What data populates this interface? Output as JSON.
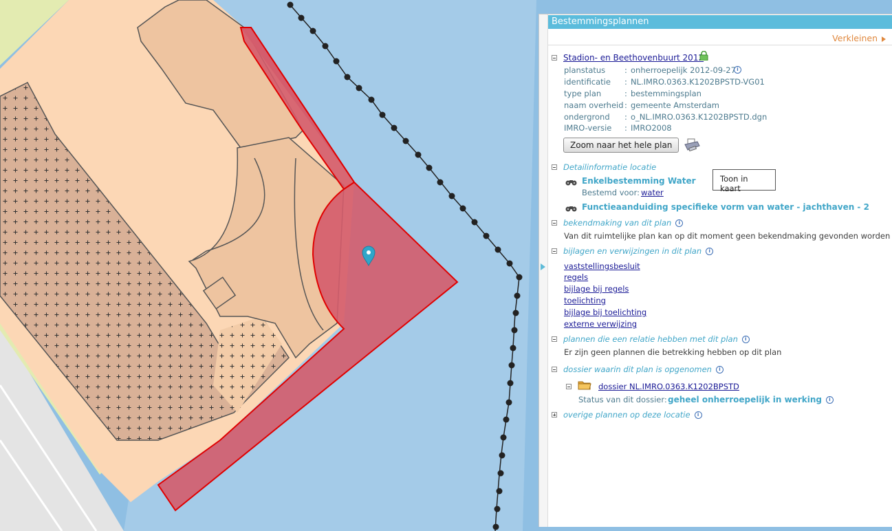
{
  "map": {
    "water_color": "#8fbfe3",
    "plan_area_color": "#d45c6c",
    "land_color": "#fcd7b5",
    "building_color": "#eec4a0",
    "hatched_color": "#d9b197",
    "green_color": "#e3ebb1",
    "road_color": "#e3e3e3",
    "marker_color": "#2fa6c9",
    "markers": {
      "pin": "location-pin-icon"
    }
  },
  "panel": {
    "title": "Bestemmingsplannen",
    "collapse_label": "Verkleinen",
    "plan": {
      "name": "Stadion- en Beethovenbuurt 2012",
      "lock_icon": "lock-icon",
      "fields": [
        {
          "label": "planstatus",
          "value": "onherroepelijk 2012-09-27",
          "has_info": true
        },
        {
          "label": "identificatie",
          "value": "NL.IMRO.0363.K1202BPSTD-VG01",
          "has_info": false
        },
        {
          "label": "type plan",
          "value": "bestemmingsplan",
          "has_info": false
        },
        {
          "label": "naam overheid",
          "value": "gemeente Amsterdam",
          "has_info": false
        },
        {
          "label": "ondergrond",
          "value": "o_NL.IMRO.0363.K1202BPSTD.dgn",
          "has_info": false
        },
        {
          "label": "IMRO-versie",
          "value": "IMRO2008",
          "has_info": false
        }
      ],
      "zoom_button": "Zoom naar het hele plan",
      "print_icon": "printer-icon"
    },
    "detail": {
      "heading": "Detailinformatie locatie",
      "items": [
        {
          "title": "Enkelbestemming Water",
          "sub_label": "Bestemd voor:",
          "sub_link": "water"
        },
        {
          "title": "Functieaanduiding specifieke vorm van water - jachthaven - 2"
        }
      ],
      "tooltip": "Toon in kaart"
    },
    "bekendmaking": {
      "heading": "bekendmaking van dit plan",
      "text": "Van dit ruimtelijke plan kan op dit moment geen bekendmaking gevonden worden"
    },
    "bijlagen": {
      "heading": "bijlagen en verwijzingen in dit plan",
      "links": [
        "vaststellingsbesluit",
        "regels",
        "bijlage bij regels",
        "toelichting",
        "bijlage bij toelichting",
        "externe verwijzing"
      ]
    },
    "relaties": {
      "heading": "plannen die een relatie hebben met dit plan",
      "text": "Er zijn geen plannen die betrekking hebben op dit plan"
    },
    "dossier": {
      "heading": "dossier waarin dit plan is opgenomen",
      "name": "dossier NL.IMRO.0363.K1202BPSTD",
      "status_label": "Status van dit dossier:",
      "status_value": "geheel onherroepelijk in werking"
    },
    "overige": {
      "heading": "overige plannen op deze locatie"
    }
  }
}
